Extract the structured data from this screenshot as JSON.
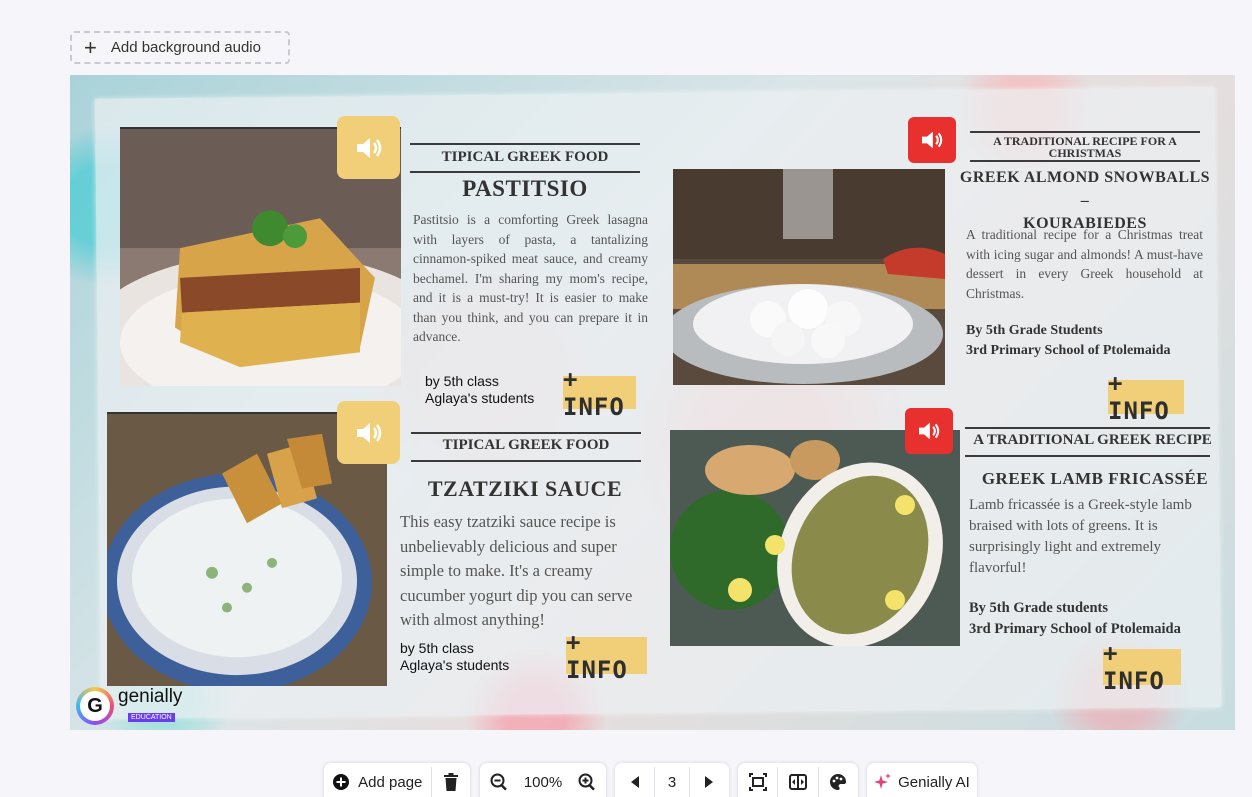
{
  "top": {
    "add_audio_label": "Add background audio"
  },
  "cards": {
    "pastitsio": {
      "subtitle": "TIPICAL GREEK FOOD",
      "title": "PASTITSIO",
      "body": "Pastitsio is a comforting Greek lasagna with layers of pasta, a tantalizing cinnamon-spiked meat sauce, and creamy bechamel. I'm sharing my mom's recipe, and it is a must-try! It is easier to make than you think, and you can prepare it in advance.",
      "by_line1": "by  5th class",
      "by_line2": "Aglaya's students",
      "info": "+ INFO"
    },
    "tzatziki": {
      "subtitle": "TIPICAL GREEK FOOD",
      "title": "TZATZIKI SAUCE",
      "body": "This easy tzatziki sauce recipe is unbelievably delicious and super simple to make. It's a creamy cucumber yogurt dip you can serve with almost anything!",
      "by_line1": "by  5th class",
      "by_line2": "Aglaya's students",
      "info": "+ INFO"
    },
    "kourabiedes": {
      "subtitle": "A TRADITIONAL RECIPE FOR A CHRISTMAS",
      "title_line1": "GREEK ALMOND SNOWBALLS –",
      "title_line2": "KOURABIEDES",
      "body": "A traditional recipe for a Christmas treat with icing sugar and almonds! A must-have dessert in every Greek household at Christmas.",
      "credit_line1": "By 5th Grade Students",
      "credit_line2": "3rd Primary School of Ptolemaida",
      "info": "+ INFO"
    },
    "fricassee": {
      "subtitle": "A TRADITIONAL GREEK RECIPE",
      "title": "GREEK LAMB FRICASSÉE",
      "body": "Lamb fricassée is a Greek-style lamb braised with lots of greens. It is surprisingly light and extremely flavorful!",
      "credit_line1": "By 5th Grade students",
      "credit_line2": "3rd Primary School of Ptolemaida",
      "info": "+ INFO"
    }
  },
  "logo": {
    "brand": "genially",
    "badge": "EDUCATION"
  },
  "toolbar": {
    "add_page": "Add page",
    "zoom": "100%",
    "page": "3",
    "ai": "Genially AI"
  },
  "colors": {
    "sound_yellow": "#f1cf79",
    "sound_red": "#e8302f",
    "info_bg": "#f1cf79"
  }
}
